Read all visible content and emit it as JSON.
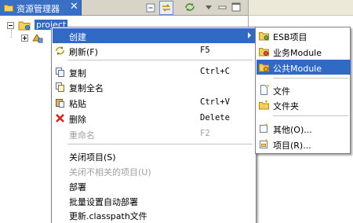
{
  "view": {
    "tab_label": "资源管理器",
    "tab_close": "✕"
  },
  "tree": {
    "project_label": "project"
  },
  "context_menu": {
    "items": [
      {
        "label": "创建",
        "accel": "",
        "icon": "none",
        "highlighted": true,
        "submenu": true
      },
      {
        "label": "刷新(F)",
        "accel": "F5",
        "icon": "refresh-icon"
      },
      {
        "label": "复制",
        "accel": "Ctrl+C",
        "icon": "copy-icon"
      },
      {
        "label": "复制全名",
        "accel": "",
        "icon": "copy-qualified-icon"
      },
      {
        "label": "粘贴",
        "accel": "Ctrl+V",
        "icon": "paste-icon"
      },
      {
        "label": "删除",
        "accel": "Delete",
        "icon": "delete-icon"
      },
      {
        "label": "重命名",
        "accel": "F2",
        "icon": "none",
        "disabled": true
      },
      {
        "label": "关闭项目(S)",
        "accel": "",
        "icon": "none"
      },
      {
        "label": "关闭不相关的项目(U)",
        "accel": "",
        "icon": "none",
        "disabled": true
      },
      {
        "label": "部署",
        "accel": "",
        "icon": "none"
      },
      {
        "label": "批量设置自动部署",
        "accel": "",
        "icon": "none"
      },
      {
        "label": "更新.classpath文件",
        "accel": "",
        "icon": "none"
      }
    ]
  },
  "submenu": {
    "items": [
      {
        "label": "ESB项目",
        "icon": "esb-project-icon"
      },
      {
        "label": "业务Module",
        "icon": "module-icon"
      },
      {
        "label": "公共Module",
        "icon": "module-icon",
        "highlighted": true
      },
      {
        "label": "文件",
        "icon": "file-icon"
      },
      {
        "label": "文件夹",
        "icon": "folder-icon"
      },
      {
        "label": "其他(O)...",
        "icon": "other-icon"
      },
      {
        "label": "项目(R)...",
        "icon": "project-icon"
      }
    ]
  },
  "colors": {
    "selection": "#316ac5",
    "tab_active": "#3a6fc6",
    "delete_red": "#d6221b"
  }
}
